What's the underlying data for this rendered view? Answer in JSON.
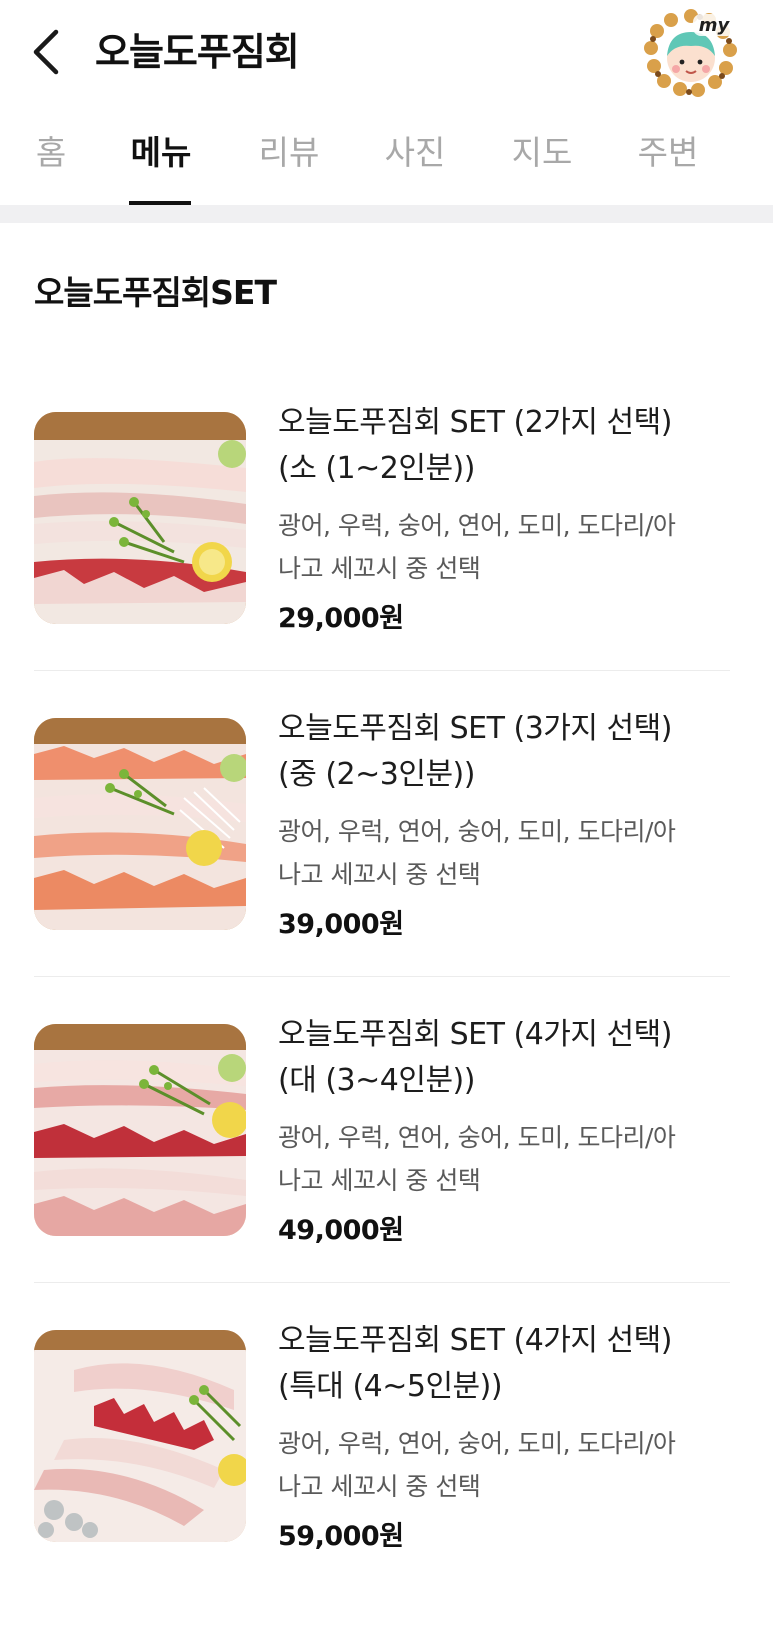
{
  "header": {
    "title": "오늘도푸짐회",
    "back_icon": "chevron-left-icon",
    "avatar_label": "my"
  },
  "tabs": [
    {
      "label": "홈",
      "active": false
    },
    {
      "label": "메뉴",
      "active": true
    },
    {
      "label": "리뷰",
      "active": false
    },
    {
      "label": "사진",
      "active": false
    },
    {
      "label": "지도",
      "active": false
    },
    {
      "label": "주변",
      "active": false
    }
  ],
  "section": {
    "title": "오늘도푸짐회SET"
  },
  "menu_items": [
    {
      "name_line1": "오늘도푸짐회 SET (2가지 선택)",
      "name_line2": "(소 (1~2인분))",
      "desc_line1": "광어, 우럭, 숭어, 연어, 도미, 도다리/아",
      "desc_line2": "나고 세꼬시 중 선택",
      "price": "29,000원"
    },
    {
      "name_line1": "오늘도푸짐회 SET (3가지 선택)",
      "name_line2": "(중 (2~3인분))",
      "desc_line1": "광어, 우럭, 연어, 숭어, 도미, 도다리/아",
      "desc_line2": "나고 세꼬시 중 선택",
      "price": "39,000원"
    },
    {
      "name_line1": "오늘도푸짐회 SET (4가지 선택)",
      "name_line2": "(대 (3~4인분))",
      "desc_line1": "광어, 우럭, 연어, 숭어, 도미, 도다리/아",
      "desc_line2": "나고 세꼬시 중 선택",
      "price": "49,000원"
    },
    {
      "name_line1": "오늘도푸짐회 SET (4가지 선택)",
      "name_line2": "(특대 (4~5인분))",
      "desc_line1": "광어, 우럭, 연어, 숭어, 도미, 도다리/아",
      "desc_line2": "나고 세꼬시 중 선택",
      "price": "59,000원"
    }
  ],
  "colors": {
    "text_primary": "#111111",
    "text_secondary": "#5a5a5a",
    "tab_inactive": "#a8a8a8",
    "divider": "#ececec",
    "band": "#f0f0f2"
  }
}
